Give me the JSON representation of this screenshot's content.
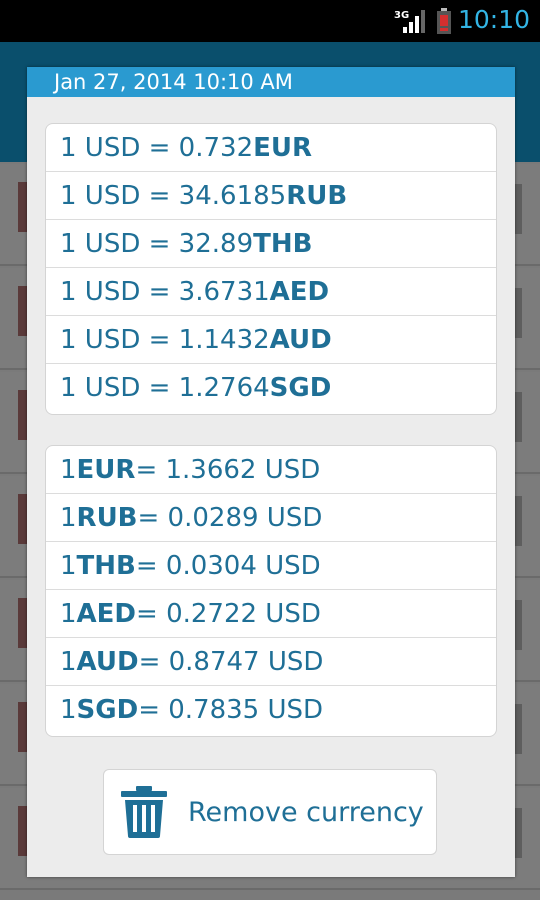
{
  "status_bar": {
    "network": "3G",
    "time": "10:10"
  },
  "dialog": {
    "title": "Jan 27, 2014 10:10 AM",
    "usd_to": [
      {
        "prefix": "1 USD = 0.732 ",
        "code": "EUR"
      },
      {
        "prefix": "1 USD = 34.6185 ",
        "code": "RUB"
      },
      {
        "prefix": "1 USD = 32.89 ",
        "code": "THB"
      },
      {
        "prefix": "1 USD = 3.6731 ",
        "code": "AED"
      },
      {
        "prefix": "1 USD = 1.1432 ",
        "code": "AUD"
      },
      {
        "prefix": "1 USD = 1.2764 ",
        "code": "SGD"
      }
    ],
    "to_usd": [
      {
        "prefix": "1 ",
        "code": "EUR",
        "suffix": " = 1.3662 USD"
      },
      {
        "prefix": "1 ",
        "code": "RUB",
        "suffix": " = 0.0289 USD"
      },
      {
        "prefix": "1 ",
        "code": "THB",
        "suffix": " = 0.0304 USD"
      },
      {
        "prefix": "1 ",
        "code": "AED",
        "suffix": " = 0.2722 USD"
      },
      {
        "prefix": "1 ",
        "code": "AUD",
        "suffix": " = 0.8747 USD"
      },
      {
        "prefix": "1 ",
        "code": "SGD",
        "suffix": " = 0.7835 USD"
      }
    ],
    "remove_button": {
      "label": "Remove currency",
      "icon": "trash-icon"
    }
  },
  "colors": {
    "accent": "#2a9ad0",
    "text": "#1f6f96",
    "status_time": "#33b5e5"
  }
}
